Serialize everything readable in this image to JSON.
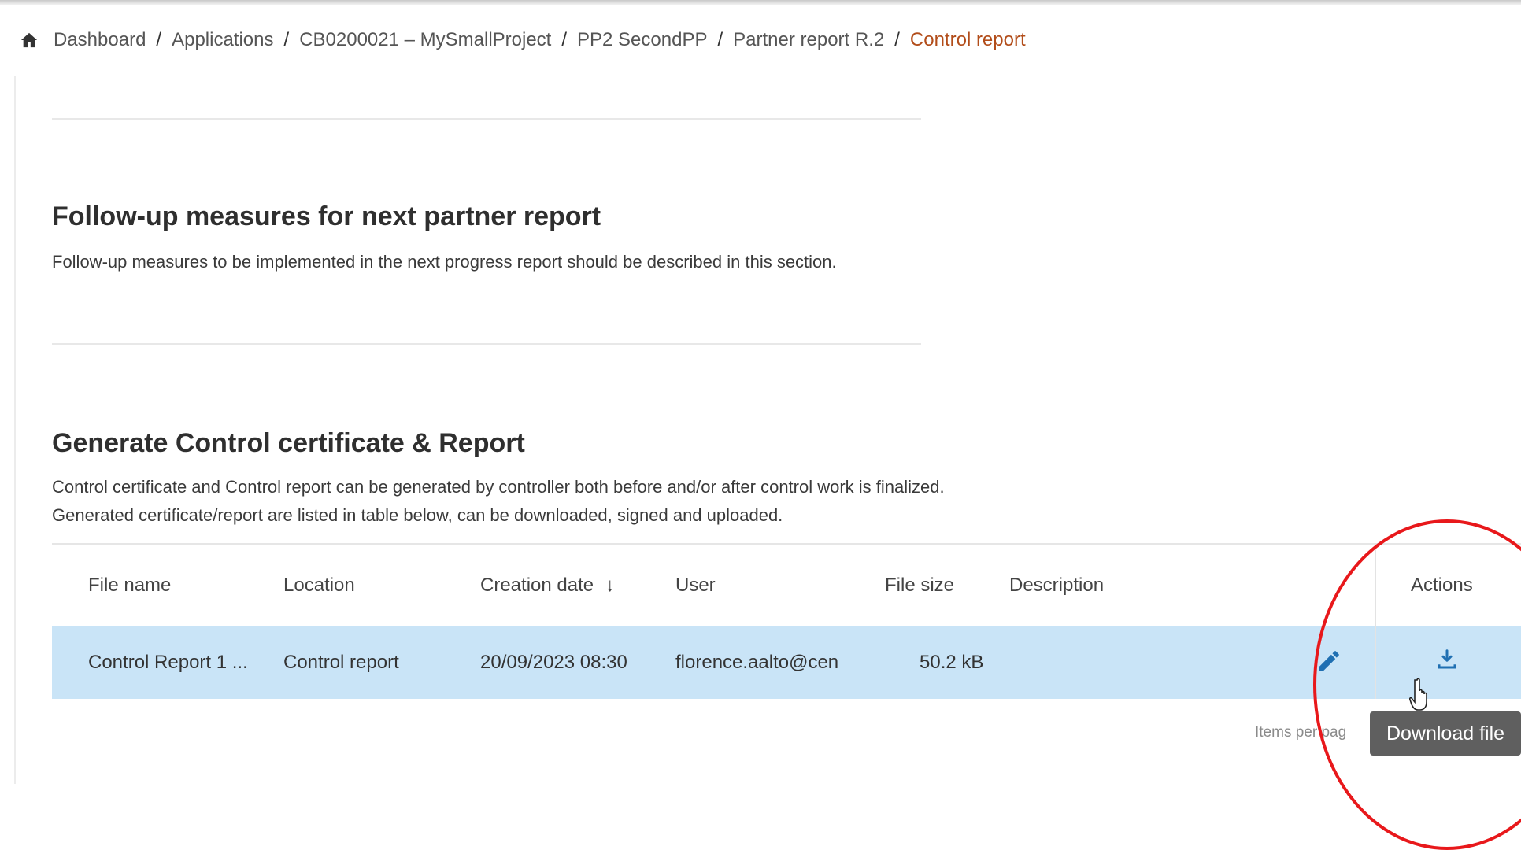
{
  "breadcrumb": {
    "items": [
      "Dashboard",
      "Applications",
      "CB0200021 – MySmallProject",
      "PP2 SecondPP",
      "Partner report R.2"
    ],
    "current": "Control report",
    "separator": "/"
  },
  "followup": {
    "title": "Follow-up measures for next partner report",
    "description": "Follow-up measures to be implemented in the next progress report should be described in this section."
  },
  "generate": {
    "title": "Generate Control certificate & Report",
    "description_line1": "Control certificate and Control report can be generated by controller both before and/or after control work is finalized.",
    "description_line2": "Generated certificate/report are listed in table below, can be downloaded, signed and uploaded."
  },
  "table": {
    "columns": {
      "file_name": "File name",
      "location": "Location",
      "creation_date": "Creation date",
      "sort_indicator": "↓",
      "user": "User",
      "file_size": "File size",
      "description": "Description",
      "actions": "Actions"
    },
    "rows": [
      {
        "file_name": "Control Report 1 ...",
        "location": "Control report",
        "creation_date": "20/09/2023 08:30",
        "user": "florence.aalto@cen",
        "file_size": "50.2 kB",
        "description": ""
      }
    ]
  },
  "paginator": {
    "label": "Items per pag"
  },
  "tooltip": {
    "text": "Download file"
  },
  "icons": {
    "home": "home-icon",
    "edit": "pencil-icon",
    "download": "download-icon",
    "cursor": "hand-pointer-cursor"
  },
  "colors": {
    "breadcrumb_current": "#b24d1a",
    "row_selected": "#c9e4f7",
    "action_icon": "#1f6fb2",
    "highlight_circle": "#e8181b"
  }
}
